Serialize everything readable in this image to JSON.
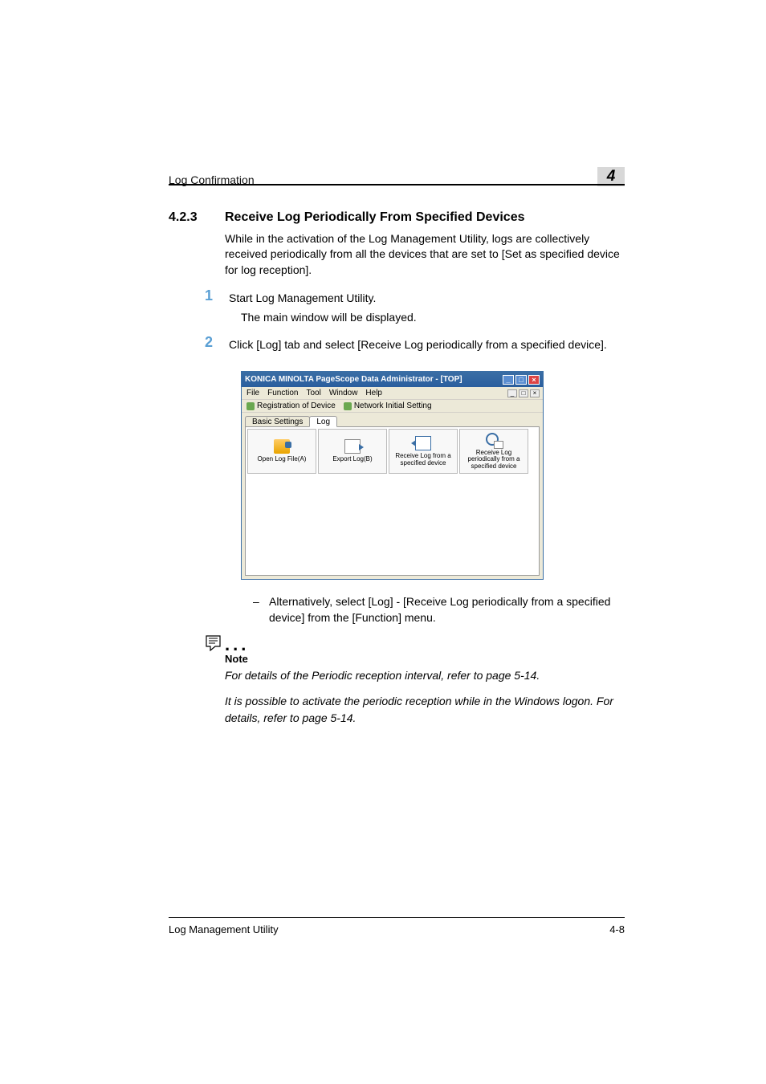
{
  "header": {
    "title": "Log Confirmation",
    "chapter_number": "4"
  },
  "section": {
    "number": "4.2.3",
    "title": "Receive Log Periodically From Specified Devices"
  },
  "intro": "While in the activation of the Log Management Utility, logs are collectively received periodically from all the devices that are set to [Set as specified device for log reception].",
  "steps": [
    {
      "num": "1",
      "text": "Start Log Management Utility.",
      "subtext": "The main window will be displayed."
    },
    {
      "num": "2",
      "text": "Click [Log] tab and select [Receive Log periodically from a specified device]."
    }
  ],
  "screenshot": {
    "window_title": "KONICA MINOLTA PageScope Data Administrator - [TOP]",
    "menus": [
      "File",
      "Function",
      "Tool",
      "Window",
      "Help"
    ],
    "toolbar_items": [
      "Registration of Device",
      "Network Initial Setting"
    ],
    "tabs": {
      "inactive": "Basic Settings",
      "active": "Log"
    },
    "tiles": [
      {
        "label": "Open Log File(A)"
      },
      {
        "label": "Export Log(B)"
      },
      {
        "label": "Receive Log from a specified device"
      },
      {
        "label": "Receive Log periodically from a specified device"
      }
    ]
  },
  "bullet": {
    "dash": "–",
    "text": "Alternatively, select [Log] - [Receive Log periodically from a specified device] from the [Function] menu."
  },
  "note": {
    "label": "Note",
    "line1": "For details of the Periodic reception interval, refer to page 5-14.",
    "line2": "It is possible to activate the periodic reception while in the Windows logon. For details, refer to page 5-14."
  },
  "footer": {
    "left": "Log Management Utility",
    "right": "4-8"
  }
}
